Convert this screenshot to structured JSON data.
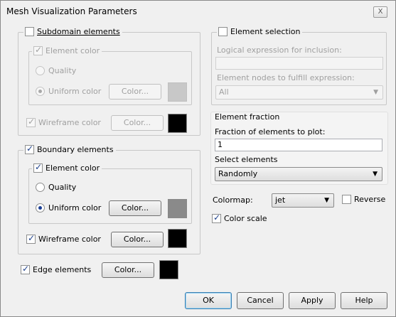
{
  "window": {
    "title": "Mesh Visualization Parameters",
    "close_glyph": "X"
  },
  "subdomain": {
    "label": "Subdomain elements",
    "checked": false,
    "element_color": {
      "label": "Element color",
      "quality_label": "Quality",
      "uniform_label": "Uniform color",
      "color_button": "Color...",
      "swatch": "#c8c8c8"
    },
    "wireframe_label": "Wireframe color",
    "wireframe_button": "Color...",
    "wireframe_swatch": "#000000"
  },
  "boundary": {
    "label": "Boundary elements",
    "checked": true,
    "element_color": {
      "label": "Element color",
      "quality_label": "Quality",
      "uniform_label": "Uniform color",
      "color_button": "Color...",
      "swatch": "#8a8a8a"
    },
    "wireframe_label": "Wireframe color",
    "wireframe_button": "Color...",
    "wireframe_swatch": "#000000"
  },
  "edge": {
    "label": "Edge elements",
    "button": "Color...",
    "swatch": "#000000"
  },
  "element_selection": {
    "label": "Element selection",
    "logical_label": "Logical expression for inclusion:",
    "logical_value": "",
    "nodes_label": "Element nodes to fulfill expression:",
    "nodes_value": "All"
  },
  "element_fraction": {
    "title": "Element fraction",
    "fraction_label": "Fraction of elements to plot:",
    "fraction_value": "1",
    "select_label": "Select elements",
    "select_value": "Randomly"
  },
  "colormap": {
    "label": "Colormap:",
    "value": "jet",
    "reverse_label": "Reverse",
    "color_scale_label": "Color scale"
  },
  "buttons": {
    "ok": "OK",
    "cancel": "Cancel",
    "apply": "Apply",
    "help": "Help"
  }
}
